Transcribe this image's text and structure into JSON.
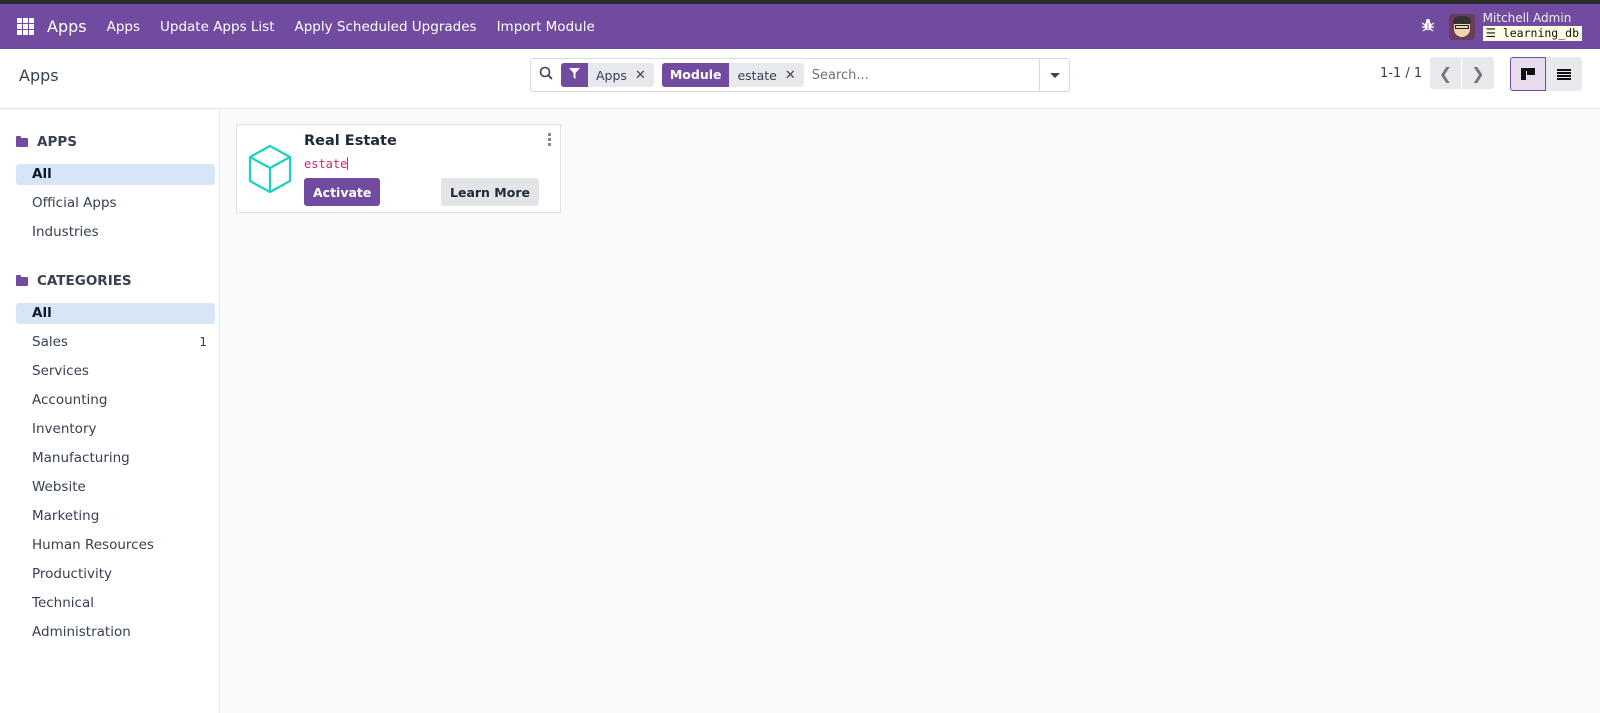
{
  "navbar": {
    "brand": "Apps",
    "menu": [
      {
        "label": "Apps"
      },
      {
        "label": "Update Apps List"
      },
      {
        "label": "Apply Scheduled Upgrades"
      },
      {
        "label": "Import Module"
      }
    ],
    "user_name": "Mitchell Admin",
    "database": "learning_db",
    "icons": {
      "apps_menu": "grid-icon",
      "debug": "bug-icon",
      "database": "database-icon"
    }
  },
  "control": {
    "breadcrumb": "Apps",
    "search": {
      "facets": [
        {
          "label": "filter-icon",
          "value": "Apps",
          "is_icon": true
        },
        {
          "label": "Module",
          "value": "estate",
          "is_icon": false
        }
      ],
      "placeholder": "Search...",
      "value": ""
    },
    "pager": "1-1 / 1",
    "views": [
      {
        "name": "kanban",
        "active": true
      },
      {
        "name": "list",
        "active": false
      }
    ]
  },
  "sidebar": {
    "apps_section": {
      "title": "APPS",
      "items": [
        {
          "label": "All",
          "active": true
        },
        {
          "label": "Official Apps"
        },
        {
          "label": "Industries"
        }
      ]
    },
    "categories_section": {
      "title": "CATEGORIES",
      "items": [
        {
          "label": "All",
          "active": true
        },
        {
          "label": "Sales",
          "count": "1"
        },
        {
          "label": "Services"
        },
        {
          "label": "Accounting"
        },
        {
          "label": "Inventory"
        },
        {
          "label": "Manufacturing"
        },
        {
          "label": "Website"
        },
        {
          "label": "Marketing"
        },
        {
          "label": "Human Resources"
        },
        {
          "label": "Productivity"
        },
        {
          "label": "Technical"
        },
        {
          "label": "Administration"
        }
      ]
    }
  },
  "cards": [
    {
      "title": "Real Estate",
      "technical_name": "estate",
      "activate_label": "Activate",
      "learn_more_label": "Learn More",
      "icon": "cube-icon",
      "icon_color": "#1ad3bb"
    }
  ],
  "colors": {
    "brand": "#714b9f",
    "active_item": "#d7e6f7",
    "technical_name": "#d6246e"
  }
}
